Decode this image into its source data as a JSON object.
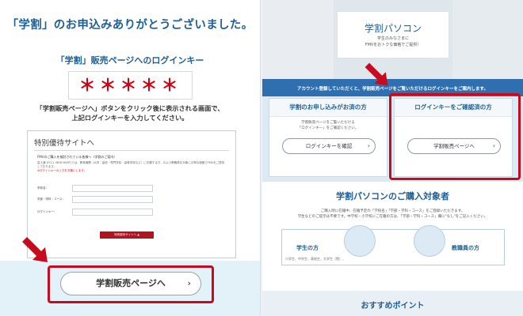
{
  "left": {
    "title": "「学割」のお申込みありがとうございました。",
    "login_key_label": "「学割」販売ページへのログインキー",
    "login_key_value": "＊＊＊＊＊",
    "instruction_1": "「学割販売ページへ」ボタンをクリック後に表示される画面で、",
    "instruction_2": "上記ログインキーを入力してください。",
    "form": {
      "title": "特別優待サイトへ",
      "heading": "FMVのご購入を検討されている皆様へ（学割のご案内）",
      "body": "富士通 (FCCL WEB MART)では、教育機関（大学・高校・専門学校・高等学校など）に在籍する方、および教職員を対象にお得な価格でFMVをご提供しております。",
      "note": "※ログインキーの入力をお願いします。",
      "fields": [
        "学校名：",
        "学部・学科・コース：",
        "ログインキー："
      ],
      "submit_label": "特別優待サイトへ"
    },
    "main_button_label": "学割販売ページへ",
    "chevron": "›"
  },
  "right": {
    "hero": {
      "title": "学割パソコン",
      "sub_1": "学生のみなさまに",
      "sub_2": "FMVをおトクな価格でご提供！"
    },
    "band_heading": "アカウント登録していただくと、学割販売ページをご覧いただけるログインキーをご案内します。",
    "card_apply": {
      "title": "学割のお申し込みがお済の方",
      "text_1": "学割販売ページをご覧いただける",
      "text_2": "「ログインキー」をご確認ください。",
      "button": "ログインキーを確認"
    },
    "card_confirmed": {
      "title": "ログインキーをご確認済の方",
      "button": "学割販売ページへ"
    },
    "lower_title": "学割パソコンのご購入対象者",
    "lower_text_1": "ご購入時に在籍中、在籍予定の「学校名」「学部・学科・コース」をご登録いただきます。",
    "lower_text_2": "学生などのご提示は不要です。中学校・小学校にご在籍の方は、「学部・学科・コース」欄に\"なし\"をご記入ください。",
    "target_student": "学生の方",
    "target_student_note": "小学生、中学生、高校生、大学生（院）、",
    "target_staff": "教職員の方",
    "recommend_title": "おすすめポイント"
  },
  "colors": {
    "accent_blue": "#1f5f97",
    "highlight_red": "#c80a1e",
    "band_blue": "#2f6fb0"
  },
  "icons": [
    "red-arrow-icon",
    "chevron-right-icon",
    "student-avatar-icon",
    "teacher-avatar-icon"
  ]
}
